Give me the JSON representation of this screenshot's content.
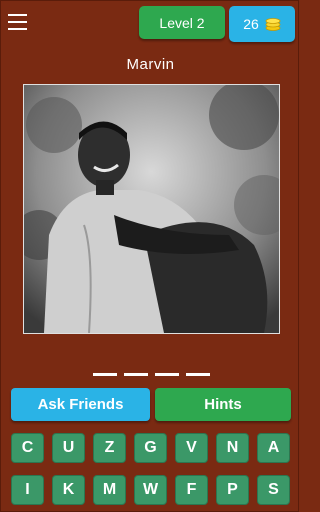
{
  "header": {
    "level_label": "Level 2",
    "coins": "26",
    "coin_icon": "coins-icon",
    "menu_icon": "hamburger-menu-icon"
  },
  "puzzle": {
    "hint_name": "Marvin",
    "answer_length": 4
  },
  "actions": {
    "ask_friends_label": "Ask Friends",
    "hints_label": "Hints"
  },
  "keyboard": {
    "row1": [
      "C",
      "U",
      "Z",
      "G",
      "V",
      "N",
      "A"
    ],
    "row2": [
      "I",
      "K",
      "M",
      "W",
      "F",
      "P",
      "S"
    ]
  },
  "colors": {
    "background": "#7a2a12",
    "level_badge": "#2ea84f",
    "coins_badge": "#2ab3e6",
    "key": "#3b9868"
  }
}
